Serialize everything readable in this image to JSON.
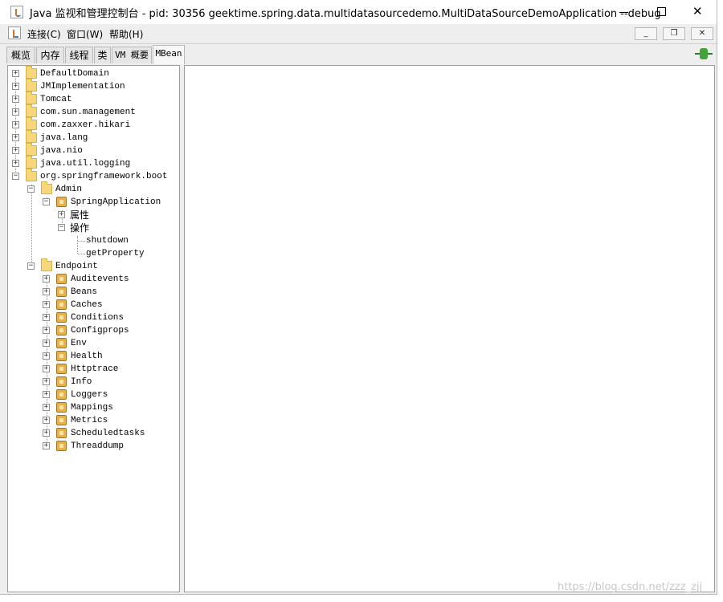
{
  "window": {
    "title": "Java 监视和管理控制台 - pid: 30356 geektime.spring.data.multidatasourcedemo.MultiDataSourceDemoApplication --debug",
    "controls": {
      "minimize": "—",
      "maximize": "□",
      "close": "✕"
    }
  },
  "menubar": {
    "items": [
      {
        "label": "连接(C)"
      },
      {
        "label": "窗口(W)"
      },
      {
        "label": "帮助(H)"
      }
    ],
    "mdi": {
      "minimize": "_",
      "restore": "❐",
      "close": "✕"
    }
  },
  "tabs": [
    {
      "label": "概览"
    },
    {
      "label": "内存"
    },
    {
      "label": "线程"
    },
    {
      "label": "类"
    },
    {
      "label": "VM 概要"
    },
    {
      "label": "MBean"
    }
  ],
  "tree": {
    "domains": [
      {
        "label": "DefaultDomain"
      },
      {
        "label": "JMImplementation"
      },
      {
        "label": "Tomcat"
      },
      {
        "label": "com.sun.management"
      },
      {
        "label": "com.zaxxer.hikari"
      },
      {
        "label": "java.lang"
      },
      {
        "label": "java.nio"
      },
      {
        "label": "java.util.logging"
      },
      {
        "label": "org.springframework.boot"
      }
    ],
    "admin": {
      "label": "Admin",
      "bean": "SpringApplication",
      "attributes": "属性",
      "operations": "操作",
      "ops": [
        "shutdown",
        "getProperty"
      ]
    },
    "endpoint": {
      "label": "Endpoint",
      "beans": [
        "Auditevents",
        "Beans",
        "Caches",
        "Conditions",
        "Configprops",
        "Env",
        "Health",
        "Httptrace",
        "Info",
        "Loggers",
        "Mappings",
        "Metrics",
        "Scheduledtasks",
        "Threaddump"
      ]
    },
    "toggle": {
      "expanded": "−",
      "collapsed": "+"
    }
  },
  "watermark": "https://blog.csdn.net/zzz_zjj",
  "icons": [
    "app-icon",
    "folder-icon",
    "mbean-icon",
    "connection-icon"
  ]
}
